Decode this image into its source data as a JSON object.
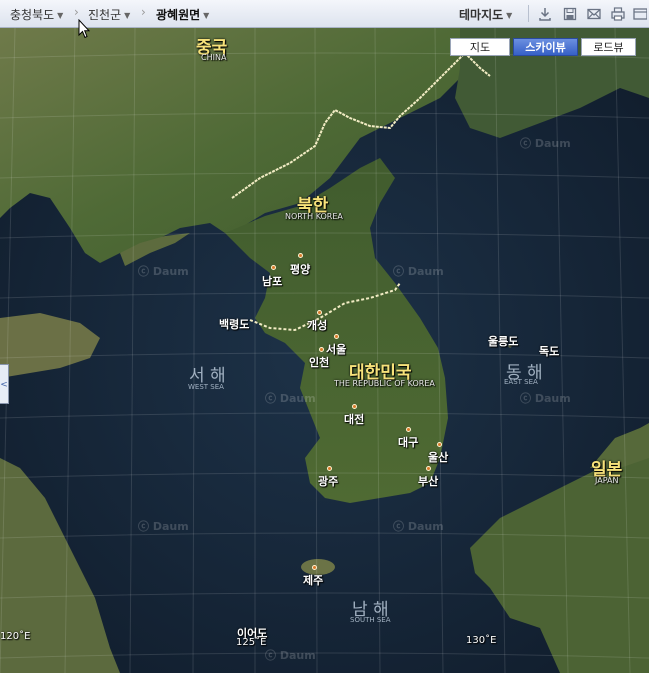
{
  "breadcrumb": {
    "province": "충청북도",
    "county": "진천군",
    "town": "광혜원면"
  },
  "theme_map_label": "테마지도",
  "tools": [
    "download-icon",
    "save-icon",
    "mail-icon",
    "print-icon",
    "fullscreen-icon"
  ],
  "map_types": {
    "map": "지도",
    "skyview": "스카이뷰",
    "roadview": "로드뷰",
    "selected": "스카이뷰"
  },
  "countries": {
    "china": {
      "name": "중국",
      "en": "CHINA"
    },
    "north_korea": {
      "name": "북한",
      "en": "NORTH KOREA"
    },
    "south_korea": {
      "name": "대한민국",
      "en": "THE REPUBLIC OF KOREA"
    },
    "japan": {
      "name": "일본",
      "en": "JAPAN"
    }
  },
  "seas": {
    "west": {
      "name": "서 해",
      "en": "WEST SEA"
    },
    "east": {
      "name": "동 해",
      "en": "EAST SEA"
    },
    "south": {
      "name": "남 해",
      "en": "SOUTH SEA"
    }
  },
  "cities": {
    "pyongyang": "평양",
    "nampo": "남포",
    "kaesong": "개성",
    "seoul": "서울",
    "incheon": "인천",
    "daejeon": "대전",
    "daegu": "대구",
    "ulsan": "울산",
    "busan": "부산",
    "gwangju": "광주",
    "jeju": "제주"
  },
  "islands": {
    "baengnyeongdo": "백령도",
    "ulleungdo": "울릉도",
    "dokdo": "독도",
    "ieodo": "이어도"
  },
  "longitudes": {
    "e120": "120˚E",
    "e125": "125˚E",
    "e130": "130˚E"
  },
  "watermark": "ⓒ Daum",
  "colors": {
    "label_highlight": "#f7e27a",
    "city_dot": "#d97b2b",
    "border_line": "#f2ecc4",
    "active_button": "#3660c7"
  }
}
